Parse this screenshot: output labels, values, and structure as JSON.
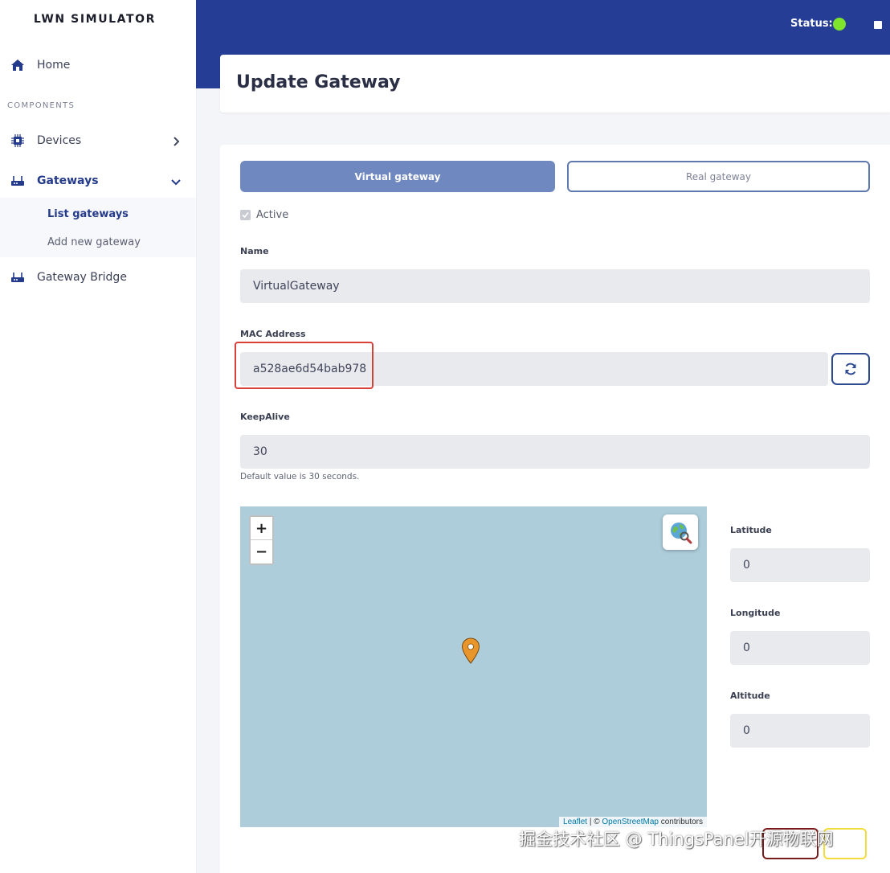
{
  "sidebar": {
    "brand": "LWN SIMULATOR",
    "section_title": "COMPONENTS",
    "items": [
      {
        "label": "Home",
        "icon": "home-icon"
      },
      {
        "label": "Devices",
        "icon": "chip-icon"
      },
      {
        "label": "Gateways",
        "icon": "router-icon"
      },
      {
        "label": "Gateway Bridge",
        "icon": "router-icon"
      }
    ],
    "subitems": [
      {
        "label": "List gateways",
        "active": true
      },
      {
        "label": "Add new gateway",
        "active": false
      }
    ]
  },
  "header": {
    "status_label": "Status:",
    "status_color": "#7ee52c"
  },
  "page": {
    "title": "Update Gateway"
  },
  "form": {
    "tab_virtual": "Virtual gateway",
    "tab_real": "Real gateway",
    "active_label": "Active",
    "active_checked": true,
    "name_label": "Name",
    "name_value": "VirtualGateway",
    "mac_label": "MAC Address",
    "mac_value": "a528ae6d54bab978",
    "keepalive_label": "KeepAlive",
    "keepalive_value": "30",
    "keepalive_hint": "Default value is 30 seconds.",
    "latitude_label": "Latitude",
    "latitude_value": "0",
    "longitude_label": "Longitude",
    "longitude_value": "0",
    "altitude_label": "Altitude",
    "altitude_value": "0"
  },
  "map": {
    "zoom_in": "+",
    "zoom_out": "−",
    "attribution_leaflet": "Leaflet",
    "attribution_sep": " | © ",
    "attribution_osm": "OpenStreetMap",
    "attribution_tail": " contributors"
  },
  "watermark": "掘金技术社区 @ ThingsPanel开源物联网",
  "colors": {
    "header": "#253d95",
    "accent": "#6f88bf",
    "map_water": "#adcddb",
    "pin": "#e8962b"
  }
}
